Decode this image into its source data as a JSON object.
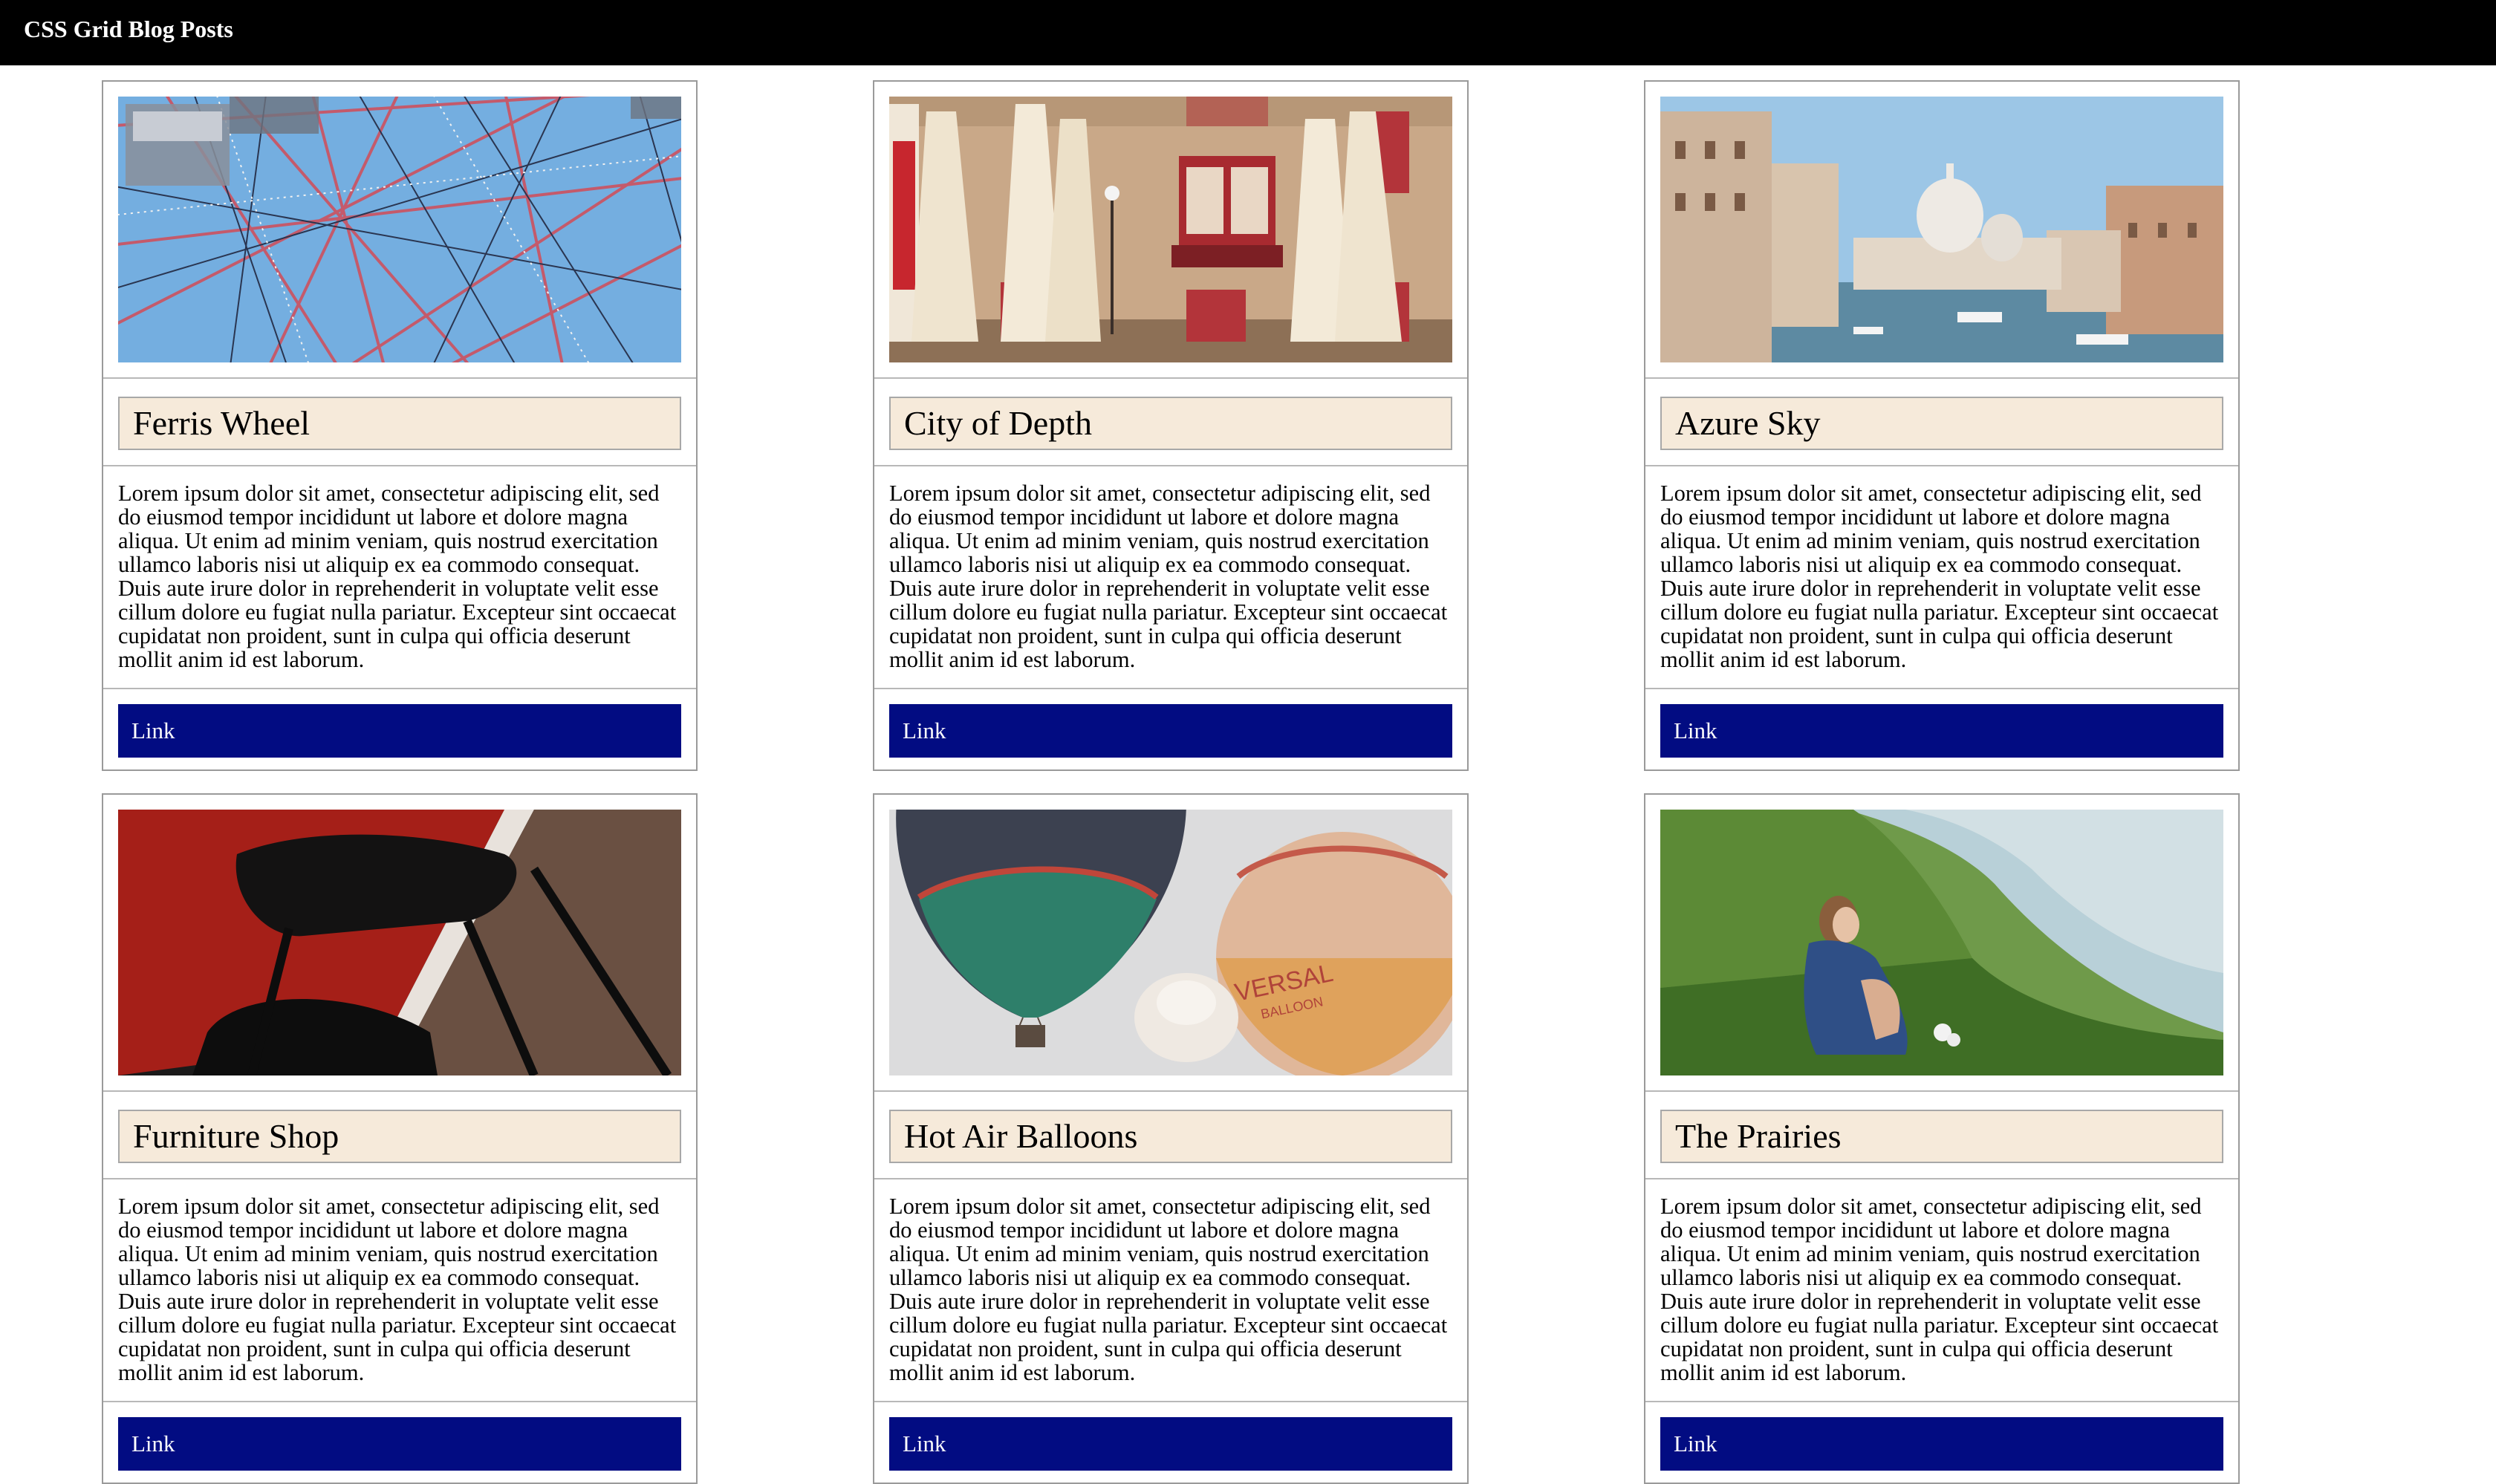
{
  "header": {
    "title": "CSS Grid Blog Posts",
    "background": "#000000"
  },
  "posts": [
    {
      "image": "ferris-wheel-photo",
      "title": "Ferris Wheel",
      "body": "Lorem ipsum dolor sit amet, consectetur adipiscing elit, sed do eiusmod tempor incididunt ut labore et dolore magna aliqua. Ut enim ad minim veniam, quis nostrud exercitation ullamco laboris nisi ut aliquip ex ea commodo consequat. Duis aute irure dolor in reprehenderit in voluptate velit esse cillum dolore eu fugiat nulla pariatur. Excepteur sint occaecat cupidatat non proident, sunt in culpa qui officia deserunt mollit anim id est laborum.",
      "link_label": "Link"
    },
    {
      "image": "city-facade-photo",
      "title": "City of Depth",
      "body": "Lorem ipsum dolor sit amet, consectetur adipiscing elit, sed do eiusmod tempor incididunt ut labore et dolore magna aliqua. Ut enim ad minim veniam, quis nostrud exercitation ullamco laboris nisi ut aliquip ex ea commodo consequat. Duis aute irure dolor in reprehenderit in voluptate velit esse cillum dolore eu fugiat nulla pariatur. Excepteur sint occaecat cupidatat non proident, sunt in culpa qui officia deserunt mollit anim id est laborum.",
      "link_label": "Link"
    },
    {
      "image": "venice-canal-photo",
      "title": "Azure Sky",
      "body": "Lorem ipsum dolor sit amet, consectetur adipiscing elit, sed do eiusmod tempor incididunt ut labore et dolore magna aliqua. Ut enim ad minim veniam, quis nostrud exercitation ullamco laboris nisi ut aliquip ex ea commodo consequat. Duis aute irure dolor in reprehenderit in voluptate velit esse cillum dolore eu fugiat nulla pariatur. Excepteur sint occaecat cupidatat non proident, sunt in culpa qui officia deserunt mollit anim id est laborum.",
      "link_label": "Link"
    },
    {
      "image": "chair-photo",
      "title": "Furniture Shop",
      "body": "Lorem ipsum dolor sit amet, consectetur adipiscing elit, sed do eiusmod tempor incididunt ut labore et dolore magna aliqua. Ut enim ad minim veniam, quis nostrud exercitation ullamco laboris nisi ut aliquip ex ea commodo consequat. Duis aute irure dolor in reprehenderit in voluptate velit esse cillum dolore eu fugiat nulla pariatur. Excepteur sint occaecat cupidatat non proident, sunt in culpa qui officia deserunt mollit anim id est laborum.",
      "link_label": "Link"
    },
    {
      "image": "hot-air-balloons-photo",
      "title": "Hot Air Balloons",
      "body": "Lorem ipsum dolor sit amet, consectetur adipiscing elit, sed do eiusmod tempor incididunt ut labore et dolore magna aliqua. Ut enim ad minim veniam, quis nostrud exercitation ullamco laboris nisi ut aliquip ex ea commodo consequat. Duis aute irure dolor in reprehenderit in voluptate velit esse cillum dolore eu fugiat nulla pariatur. Excepteur sint occaecat cupidatat non proident, sunt in culpa qui officia deserunt mollit anim id est laborum.",
      "link_label": "Link"
    },
    {
      "image": "prairie-river-photo",
      "title": "The Prairies",
      "body": "Lorem ipsum dolor sit amet, consectetur adipiscing elit, sed do eiusmod tempor incididunt ut labore et dolore magna aliqua. Ut enim ad minim veniam, quis nostrud exercitation ullamco laboris nisi ut aliquip ex ea commodo consequat. Duis aute irure dolor in reprehenderit in voluptate velit esse cillum dolore eu fugiat nulla pariatur. Excepteur sint occaecat cupidatat non proident, sunt in culpa qui officia deserunt mollit anim id est laborum.",
      "link_label": "Link"
    }
  ],
  "colors": {
    "title_box": "#f6eada",
    "link_button": "#020c82",
    "link_text": "#ffffff",
    "card_border": "#9a9a9a"
  }
}
